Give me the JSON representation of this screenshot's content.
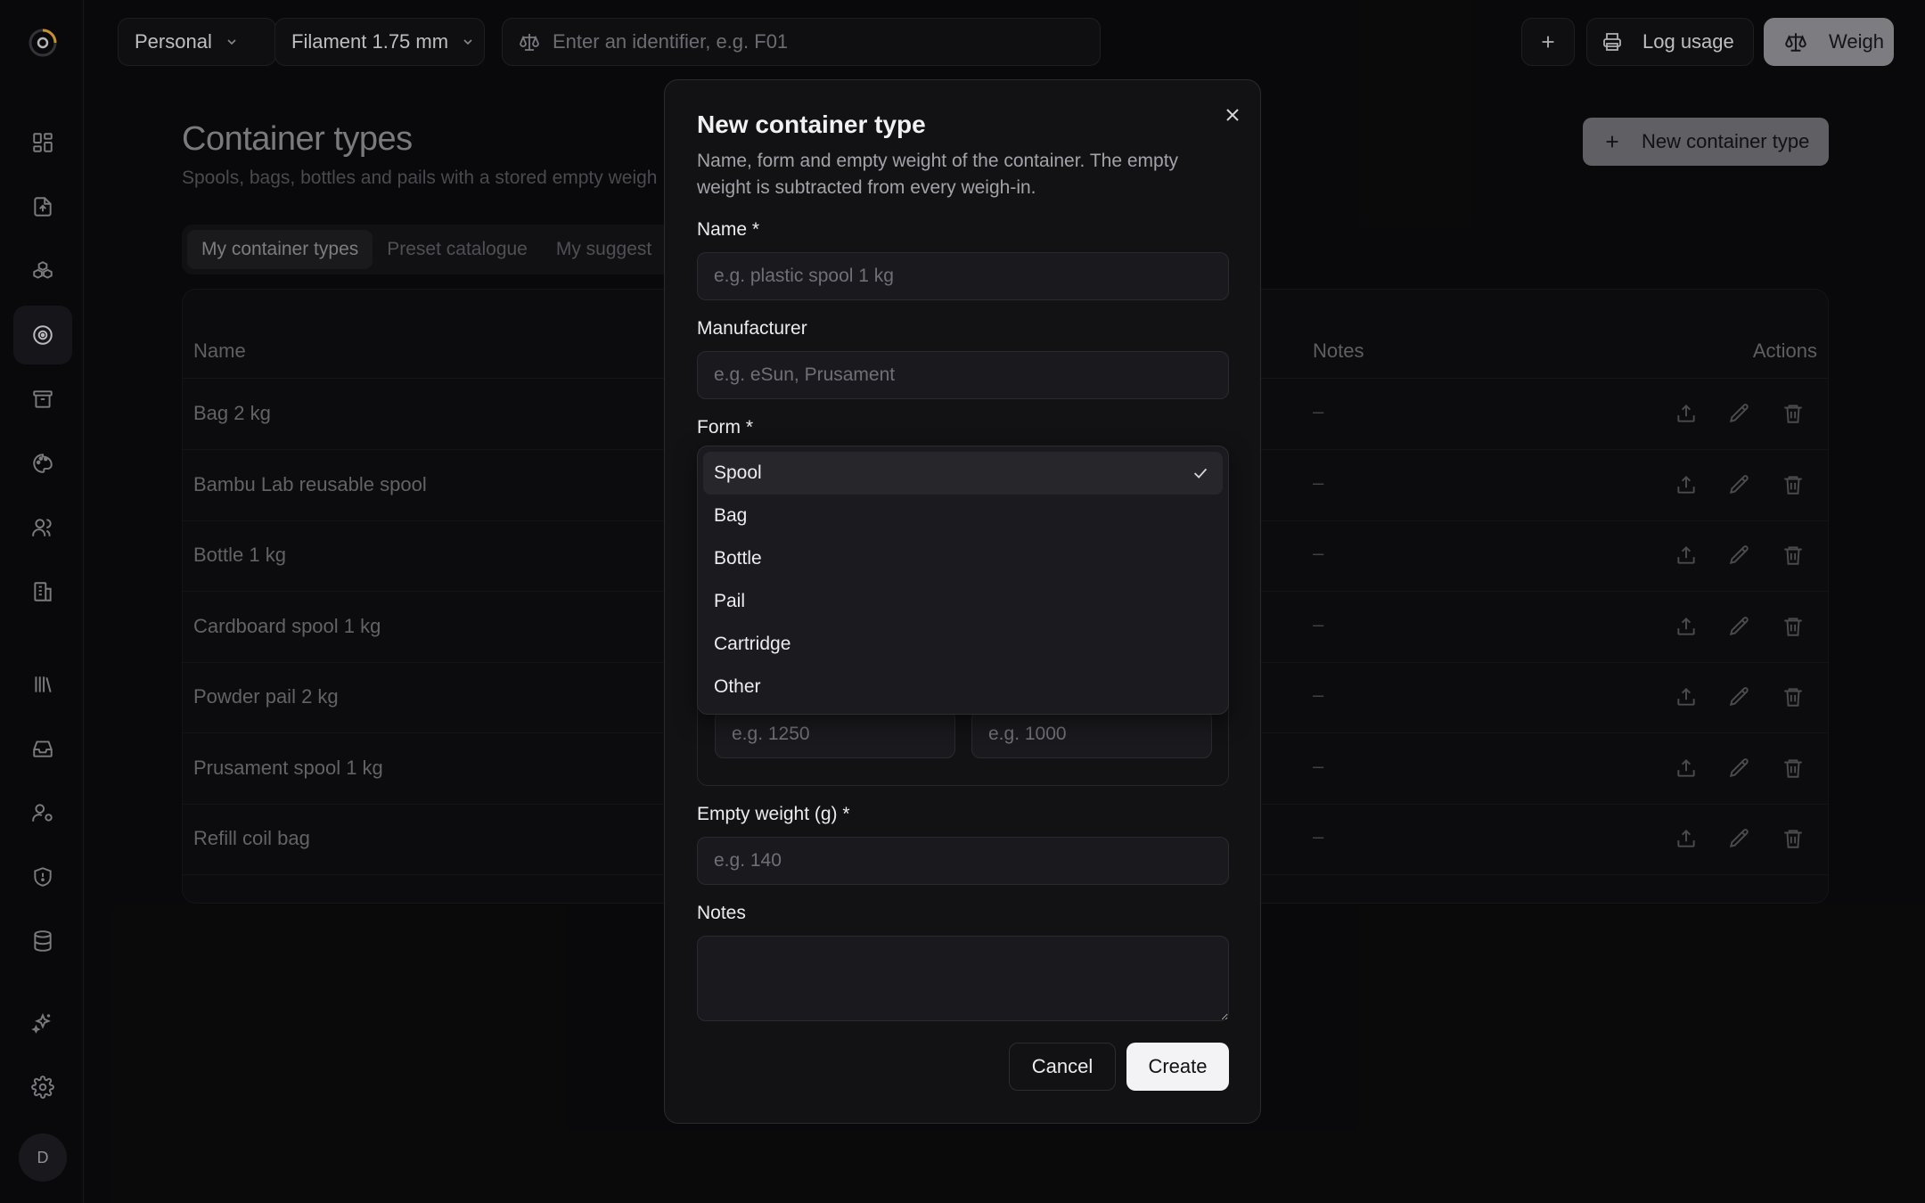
{
  "sidebar": {
    "items": [
      {
        "name": "dashboard-icon"
      },
      {
        "name": "upload-file-icon"
      },
      {
        "name": "boxes-icon"
      },
      {
        "name": "spool-icon",
        "active": true
      },
      {
        "name": "archive-icon"
      },
      {
        "name": "palette-icon"
      },
      {
        "name": "users-icon"
      },
      {
        "name": "building-icon"
      },
      {
        "name": "library-icon"
      },
      {
        "name": "inbox-icon"
      },
      {
        "name": "user-settings-icon"
      },
      {
        "name": "shield-icon"
      },
      {
        "name": "database-icon"
      },
      {
        "name": "sparkles-icon"
      },
      {
        "name": "gear-icon"
      }
    ],
    "avatar_initial": "D"
  },
  "topbar": {
    "workspace": "Personal",
    "filament": "Filament 1.75 mm",
    "search_placeholder": "Enter an identifier, e.g. F01",
    "log_usage": "Log usage",
    "weigh": "Weigh"
  },
  "page": {
    "title": "Container types",
    "subtitle": "Spools, bags, bottles and pails with a stored empty weigh",
    "new_button": "New container type",
    "tabs": [
      "My container types",
      "Preset catalogue",
      "My suggest"
    ],
    "table": {
      "headers": {
        "name": "Name",
        "notes": "Notes",
        "actions": "Actions"
      },
      "rows": [
        {
          "name": "Bag 2 kg",
          "notes": "–"
        },
        {
          "name": "Bambu Lab reusable spool",
          "notes": "–"
        },
        {
          "name": "Bottle 1 kg",
          "notes": "–"
        },
        {
          "name": "Cardboard spool 1 kg",
          "notes": "–"
        },
        {
          "name": "Powder pail 2 kg",
          "notes": "–"
        },
        {
          "name": "Prusament spool 1 kg",
          "notes": "–"
        },
        {
          "name": "Refill coil bag",
          "notes": "–"
        }
      ]
    }
  },
  "modal": {
    "title": "New container type",
    "description": "Name, form and empty weight of the container. The empty weight is subtracted from every weigh-in.",
    "name_label": "Name *",
    "name_placeholder": "e.g. plastic spool 1 kg",
    "manufacturer_label": "Manufacturer",
    "manufacturer_placeholder": "e.g. eSun, Prusament",
    "form_label": "Form *",
    "form_options": [
      "Spool",
      "Bag",
      "Bottle",
      "Pail",
      "Cartridge",
      "Other"
    ],
    "form_selected": "Spool",
    "dim_placeholder_1": "e.g. 1250",
    "dim_placeholder_2": "e.g. 1000",
    "empty_weight_label": "Empty weight (g) *",
    "empty_weight_placeholder": "e.g. 140",
    "notes_label": "Notes",
    "cancel": "Cancel",
    "create": "Create"
  }
}
